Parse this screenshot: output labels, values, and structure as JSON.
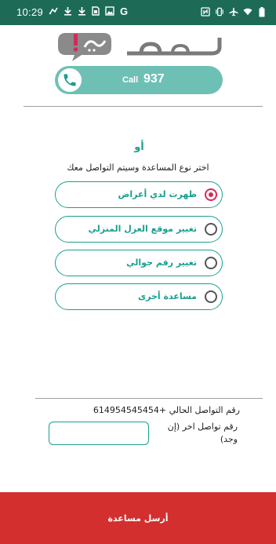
{
  "status_bar": {
    "time": "10:29",
    "left_icons": [
      "signal-icon",
      "download-icon",
      "download-icon",
      "sim-icon",
      "image-icon",
      "google-icon"
    ],
    "right_icons": [
      "nfc-icon",
      "vibrate-icon",
      "airplane-icon",
      "wifi-icon",
      "battery-icon"
    ],
    "background_color": "#1d6b57"
  },
  "logo": {
    "alt": "ما هو!"
  },
  "call": {
    "label": "Call",
    "number": "937",
    "color": "#6fc0b4"
  },
  "form": {
    "or_text": "أو",
    "instruction": "اختر نوع المساعدة وسيتم التواصل معك",
    "options": [
      {
        "label": "ظهرت لدي أعراض",
        "selected": true
      },
      {
        "label": "تغيير موقع العزل المنزلي",
        "selected": false
      },
      {
        "label": "تغيير رقم جوالي",
        "selected": false
      },
      {
        "label": "مساعدة أخرى",
        "selected": false
      }
    ],
    "accent_color": "#1a9f8f",
    "selected_color": "#d12c5b"
  },
  "contact": {
    "current_number_text": "رقم التواصل الحالي +614954545454",
    "alt_label": "رقم تواصل اخر (إن وجد)",
    "alt_value": "",
    "alt_placeholder": ""
  },
  "submit": {
    "label": "أرسل مساعدة",
    "color": "#d32f2f"
  }
}
